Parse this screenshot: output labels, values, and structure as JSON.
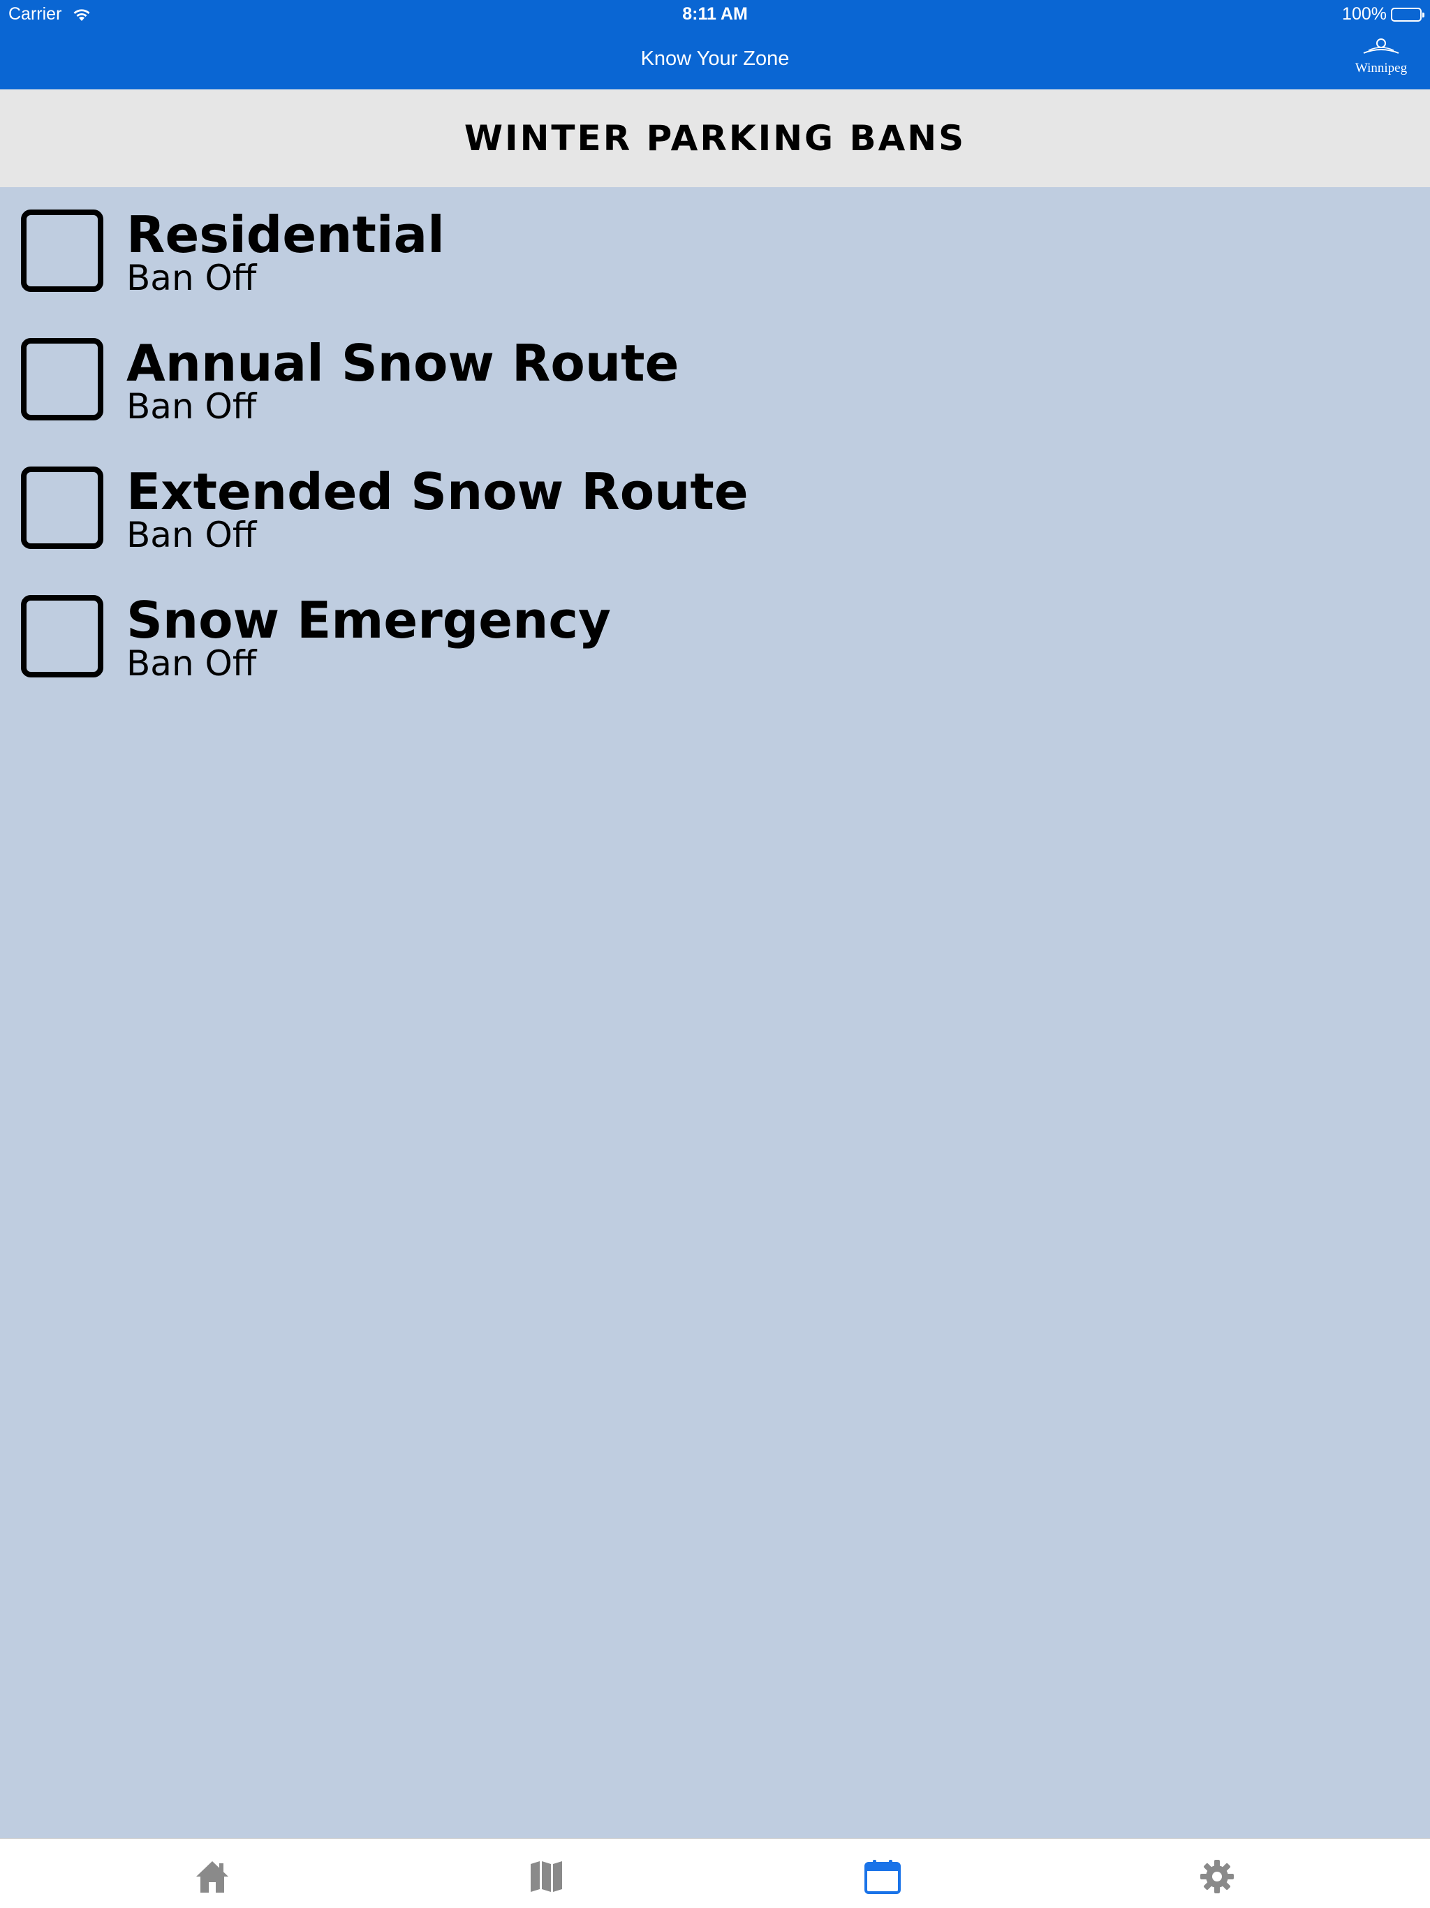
{
  "status_bar": {
    "carrier": "Carrier",
    "time": "8:11 AM",
    "battery": "100%"
  },
  "nav": {
    "title": "Know Your Zone",
    "logo_text": "Winnipeg"
  },
  "section": {
    "title": "WINTER PARKING BANS"
  },
  "bans": [
    {
      "name": "Residential",
      "status": "Ban Off",
      "checked": false
    },
    {
      "name": "Annual Snow Route",
      "status": "Ban Off",
      "checked": false
    },
    {
      "name": "Extended Snow Route",
      "status": "Ban Off",
      "checked": false
    },
    {
      "name": "Snow Emergency",
      "status": "Ban Off",
      "checked": false
    }
  ],
  "tabs": [
    {
      "icon": "home-icon",
      "active": false
    },
    {
      "icon": "map-icon",
      "active": false
    },
    {
      "icon": "calendar-icon",
      "active": true
    },
    {
      "icon": "gear-icon",
      "active": false
    }
  ],
  "colors": {
    "nav_blue": "#0a66d3",
    "background": "#bfcde0",
    "header_gray": "#e6e6e6",
    "tab_active": "#1a73e8",
    "tab_inactive": "#8a8a8a"
  }
}
